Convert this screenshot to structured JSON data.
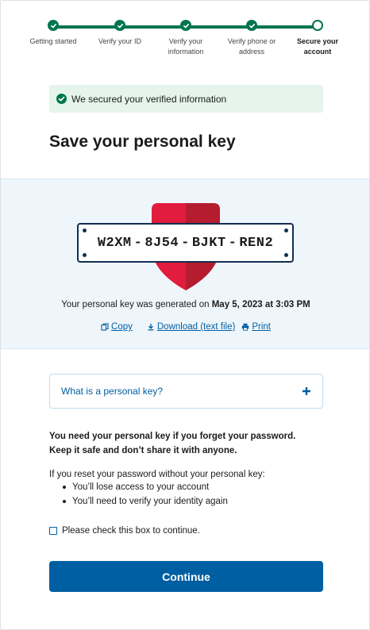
{
  "steps": [
    {
      "label": "Getting started",
      "state": "complete"
    },
    {
      "label": "Verify your ID",
      "state": "complete"
    },
    {
      "label": "Verify your information",
      "state": "complete"
    },
    {
      "label": "Verify phone or address",
      "state": "complete"
    },
    {
      "label": "Secure your account",
      "state": "current"
    }
  ],
  "alert": {
    "text": "We secured your verified information",
    "icon": "check-circle-icon"
  },
  "page_title": "Save your personal key",
  "personal_key": {
    "parts": [
      "W2XM",
      "8J54",
      "BJKT",
      "REN2"
    ],
    "separator": "-"
  },
  "generated": {
    "prefix": "Your personal key was generated on",
    "datetime": "May 5, 2023 at 3:03 PM"
  },
  "actions": {
    "copy": "Copy",
    "download": "Download (text file)",
    "print": "Print"
  },
  "accordion": {
    "label": "What is a personal key?",
    "icon": "plus-icon"
  },
  "warning": {
    "line1": "You need your personal key if you forget your password.",
    "line2": "Keep it safe and don’t share it with anyone."
  },
  "reset": {
    "intro": "If you reset your password without your personal key:",
    "items": [
      "You’ll lose access to your account",
      "You’ll need to verify your identity again"
    ]
  },
  "checkbox_label": "Please check this box to continue.",
  "continue_label": "Continue",
  "colors": {
    "primary": "#005ea2",
    "success": "#00754e",
    "alert_bg": "#e5f5ec",
    "panel_bg": "#eff6fb",
    "shield_red": "#e21c3d",
    "shield_dark": "#b51d2f"
  }
}
